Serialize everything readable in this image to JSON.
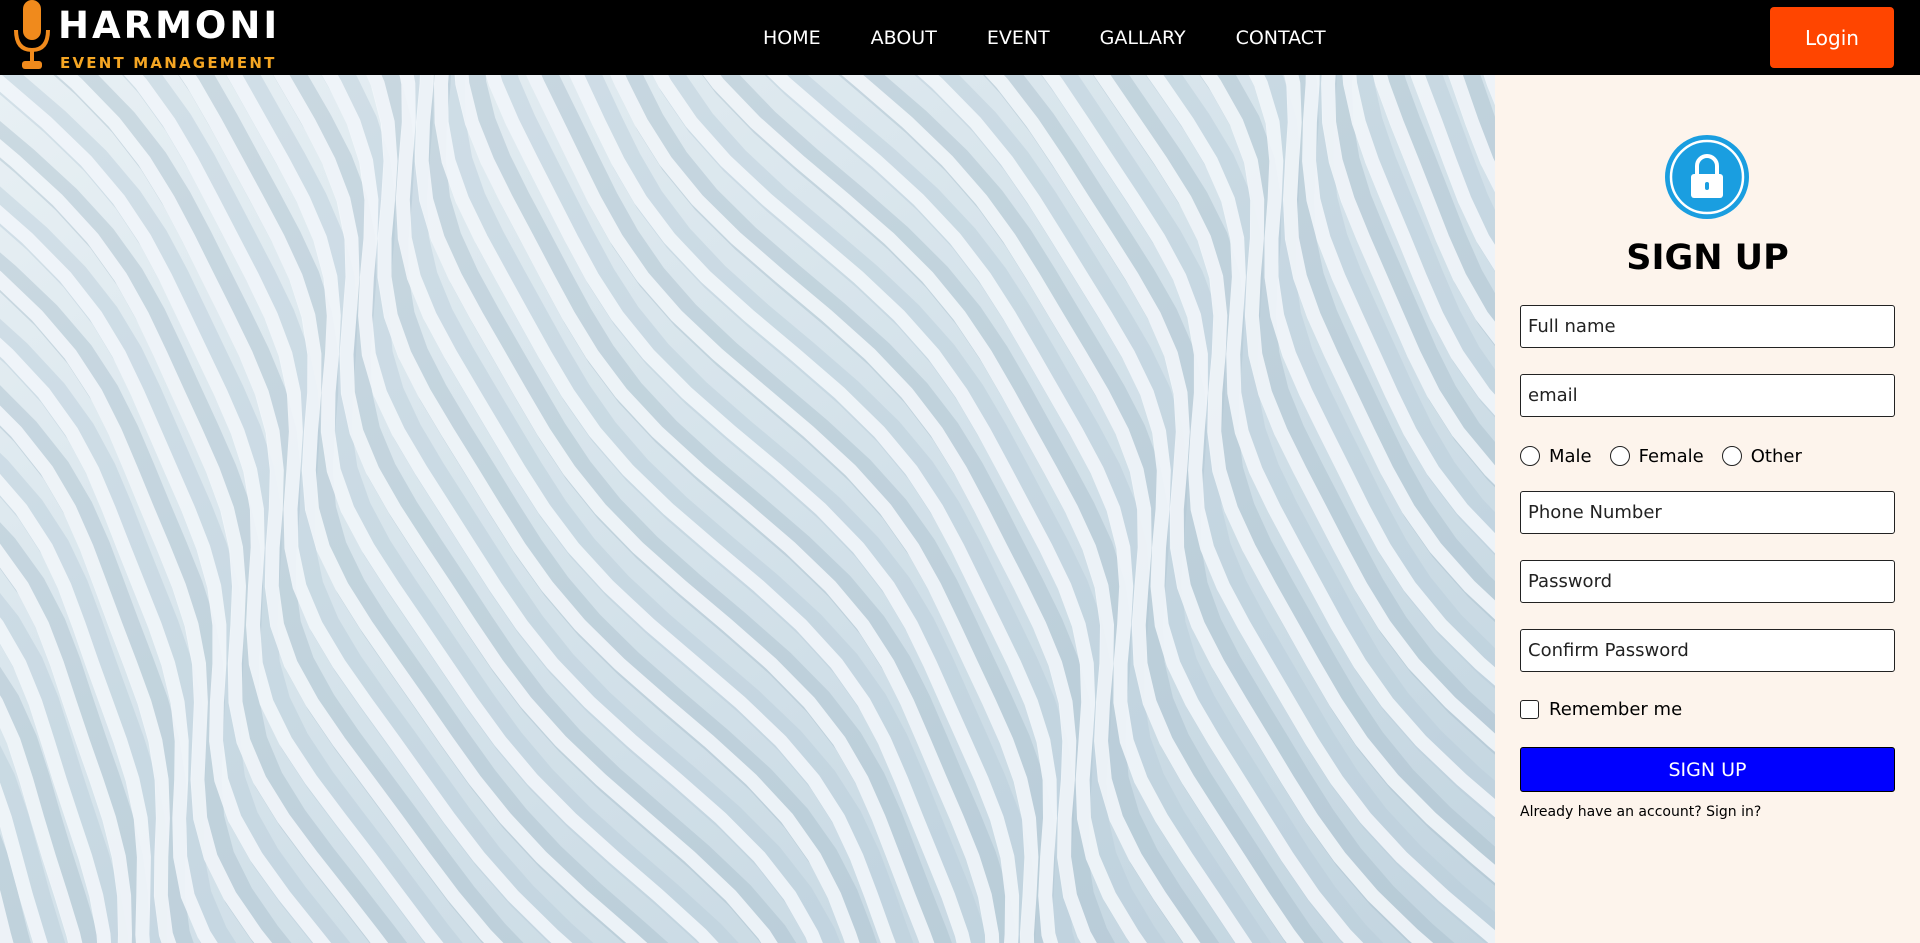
{
  "brand": {
    "name": "HARMONI",
    "tagline": "EVENT MANAGEMENT",
    "logo_icon": "microphone-icon",
    "accent_color": "#f5a623"
  },
  "nav": {
    "items": [
      {
        "label": "HOME"
      },
      {
        "label": "ABOUT"
      },
      {
        "label": "EVENT"
      },
      {
        "label": "GALLARY"
      },
      {
        "label": "CONTACT"
      }
    ],
    "login_label": "Login",
    "login_color": "#ff4500"
  },
  "hero": {
    "image": "abstract-white-waves"
  },
  "signup": {
    "icon": "lock-icon",
    "icon_color": "#1a9ee0",
    "title": "SIGN UP",
    "full_name_placeholder": "Full name",
    "email_placeholder": "email",
    "gender_options": [
      "Male",
      "Female",
      "Other"
    ],
    "phone_placeholder": "Phone Number",
    "password_placeholder": "Password",
    "confirm_password_placeholder": "Confirm Password",
    "remember_label": "Remember me",
    "submit_label": "SIGN UP",
    "submit_color": "#0000ff",
    "signin_prompt": "Already have an account? Sign in?",
    "panel_background": "#fdf4ec"
  }
}
